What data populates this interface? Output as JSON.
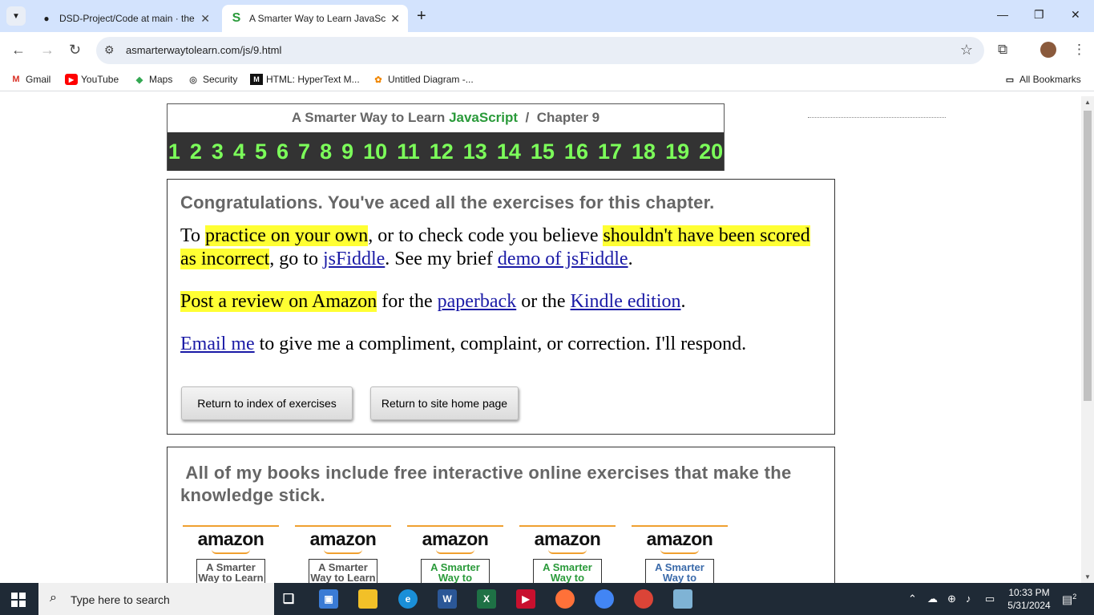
{
  "browser": {
    "tabs": [
      {
        "title": "DSD-Project/Code at main · the",
        "active": false
      },
      {
        "title": "A Smarter Way to Learn JavaScr",
        "active": true
      }
    ],
    "url": "asmarterwaytolearn.com/js/9.html",
    "bookmarks": [
      "Gmail",
      "YouTube",
      "Maps",
      "Security",
      "HTML: HyperText M...",
      "Untitled Diagram -..."
    ],
    "all_bookmarks": "All Bookmarks"
  },
  "header": {
    "prefix": "A Smarter Way to Learn",
    "brand": "JavaScript",
    "separator": "/",
    "chapter": "Chapter 9",
    "chapters": [
      "1",
      "2",
      "3",
      "4",
      "5",
      "6",
      "7",
      "8",
      "9",
      "10",
      "11",
      "12",
      "13",
      "14",
      "15",
      "16",
      "17",
      "18",
      "19",
      "20"
    ]
  },
  "congrats": {
    "heading": "Congratulations. You've aced all the exercises for this chapter.",
    "p1": {
      "t1": "To ",
      "h1": "practice on your own",
      "t2": ", or to check code you believe ",
      "h2": "shouldn't have been scored as incorrect",
      "t3": ", go to ",
      "l1": "jsFiddle",
      "t4": ". See my brief ",
      "l2": "demo of jsFiddle",
      "t5": "."
    },
    "p2": {
      "h1": "Post a review on Amazon",
      "t1": " for the ",
      "l1": "paperback",
      "t2": " or the ",
      "l2": "Kindle edition",
      "t3": "."
    },
    "p3": {
      "l1": "Email me",
      "t1": " to give me a compliment, complaint, or correction. I'll respond."
    },
    "buttons": {
      "index": "Return to index of exercises",
      "home": "Return to site home page"
    }
  },
  "books": {
    "heading": "All of my books include free interactive online exercises that make the knowledge stick.",
    "logo": "amazon",
    "covers": [
      {
        "text": "A Smarter Way to Learn",
        "color": "#555555"
      },
      {
        "text": "A Smarter Way to Learn",
        "color": "#555555"
      },
      {
        "text": "A Smarter Way to",
        "color": "#2a9a3a"
      },
      {
        "text": "A Smarter Way to",
        "color": "#2a9a3a"
      },
      {
        "text": "A Smarter Way to",
        "color": "#3a6aaa"
      }
    ]
  },
  "taskbar": {
    "search_placeholder": "Type here to search",
    "time": "10:33 PM",
    "date": "5/31/2024",
    "notifications": "2"
  }
}
